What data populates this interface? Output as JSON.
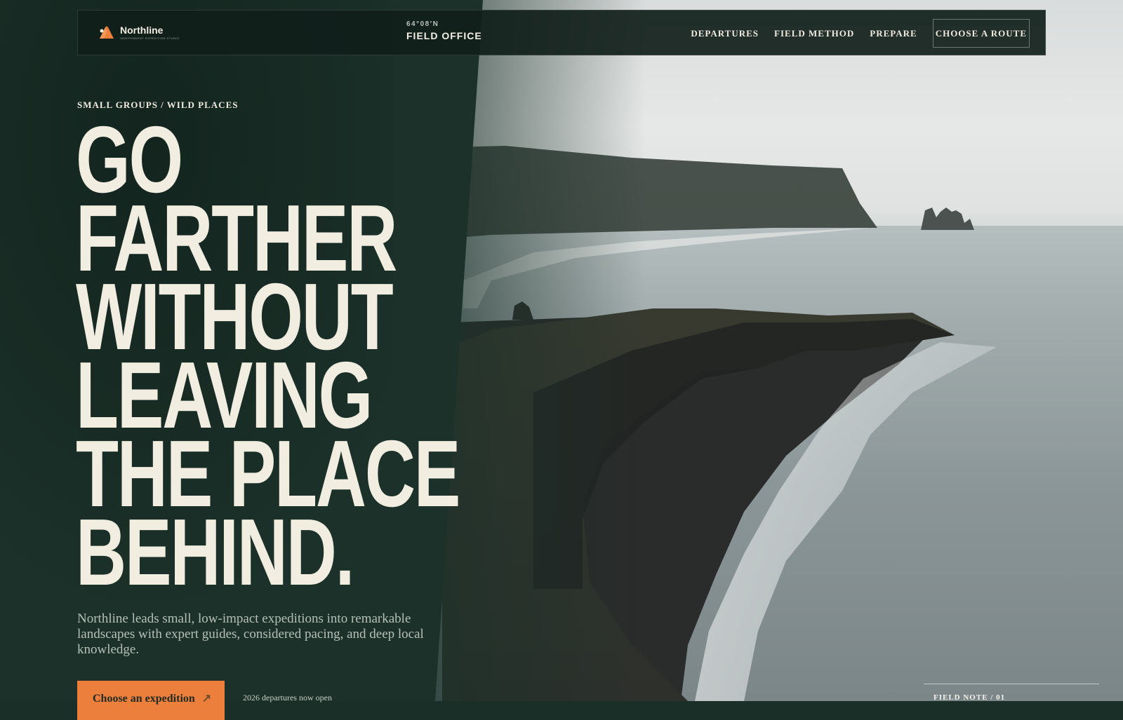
{
  "brand": {
    "name": "Northline",
    "tagline": "INDEPENDENT EXPEDITION STUDIO",
    "logo_color": "#ec7f3c"
  },
  "office": {
    "coordinate": "64°08′N",
    "name": "FIELD OFFICE"
  },
  "nav": {
    "items": [
      {
        "label": "DEPARTURES"
      },
      {
        "label": "FIELD METHOD"
      },
      {
        "label": "PREPARE"
      }
    ],
    "cta_label": "CHOOSE A ROUTE"
  },
  "hero": {
    "eyebrow": "SMALL GROUPS / WILD PLACES",
    "headline_lines": [
      "GO",
      "FARTHER",
      "WITHOUT",
      "LEAVING",
      "THE PLACE",
      "BEHIND."
    ],
    "lede": "Northline leads small, low-impact expeditions into remarkable landscapes with expert guides, considered pacing, and deep local knowledge.",
    "primary_button": "Choose an expedition",
    "primary_arrow": "arrow-right-icon",
    "departures_note": "2026 departures now open",
    "field_note": "FIELD NOTE / 01"
  },
  "colors": {
    "panel": "#1b3129",
    "accent": "#ec7f3c",
    "text_light": "#f1ede1"
  }
}
